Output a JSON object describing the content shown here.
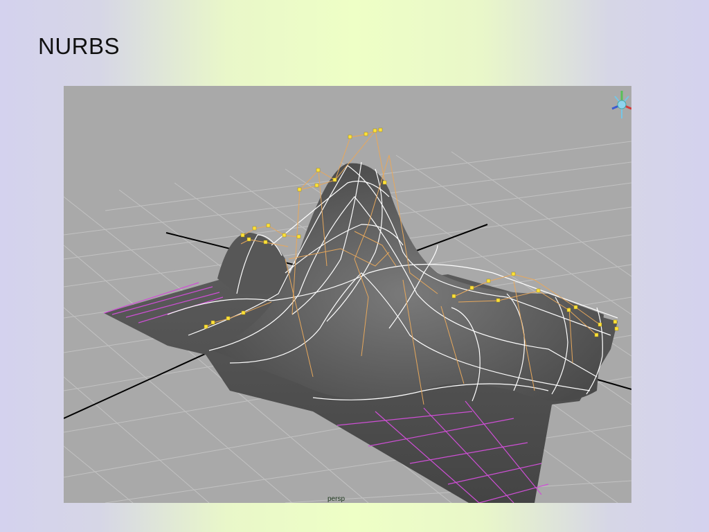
{
  "slide": {
    "title": "NURBS"
  },
  "viewport": {
    "camera_label": "persp",
    "background_color": "#a9a9a9",
    "grid_color": "#c2c2c2",
    "axis_color": "#000000",
    "surface_color": "#5c5c5c",
    "isoparm_color": "#ffffff",
    "hull_color": "#e7a85c",
    "cv_color": "#ffe23a",
    "highlight_color": "#cf4fd6"
  },
  "view_cube": {
    "icon": "view-axis-gizmo-icon",
    "axis_colors": {
      "x": "#d23b3b",
      "y": "#58c058",
      "z": "#3b5bd2"
    }
  }
}
